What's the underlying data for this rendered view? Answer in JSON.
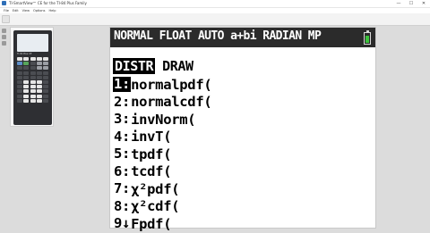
{
  "window": {
    "title": "TI-SmartView™ CE for the TI-84 Plus Family",
    "minimize": "—",
    "maximize": "☐",
    "close": "✕"
  },
  "menubar": [
    "File",
    "Edit",
    "View",
    "Options",
    "Help"
  ],
  "keypad": {
    "brand": "TI-84 Plus CE"
  },
  "calculator": {
    "status": "NORMAL FLOAT AUTO a+bi RADIAN MP",
    "battery_level": 0.85,
    "battery_color": "#3cc23c",
    "tabs": [
      {
        "label": "DISTR",
        "active": true
      },
      {
        "label": "DRAW",
        "active": false
      }
    ],
    "items": [
      {
        "num": "1:",
        "label": "normalpdf("
      },
      {
        "num": "2:",
        "label": "normalcdf("
      },
      {
        "num": "3:",
        "label": "invNorm("
      },
      {
        "num": "4:",
        "label": "invT("
      },
      {
        "num": "5:",
        "label": "tpdf("
      },
      {
        "num": "6:",
        "label": "tcdf("
      },
      {
        "num": "7:",
        "label": "χ²pdf("
      },
      {
        "num": "8:",
        "label": "χ²cdf("
      },
      {
        "num": "9↓",
        "label": "Fpdf("
      }
    ]
  }
}
